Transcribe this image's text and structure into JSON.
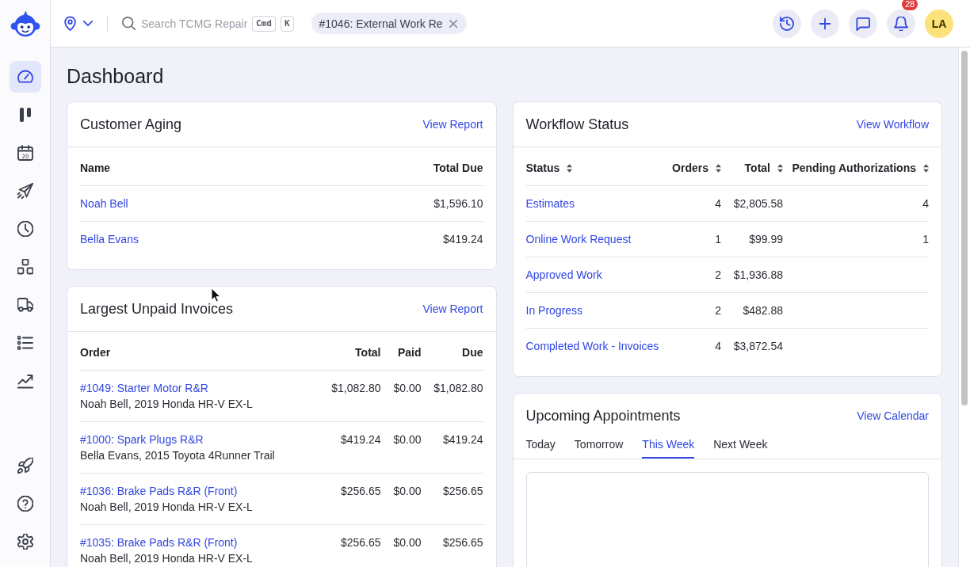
{
  "sidebar": {
    "nav_items": [
      {
        "selected": true
      },
      {
        "selected": false
      },
      {
        "selected": false,
        "date": "20"
      },
      {
        "selected": false
      },
      {
        "selected": false
      },
      {
        "selected": false
      },
      {
        "selected": false
      },
      {
        "selected": false
      },
      {
        "selected": false
      }
    ],
    "bottom_items": [
      {
        "selected": false
      },
      {
        "selected": false
      },
      {
        "selected": false
      }
    ]
  },
  "topbar": {
    "search": {
      "placeholder": "Search TCMG Repair",
      "shortcut_keys": [
        "Cmd",
        "K"
      ]
    },
    "open_tabs": [
      {
        "title": "#1046: External Work Re"
      }
    ],
    "notifications": {
      "count": "28"
    },
    "avatar": {
      "initials": "LA"
    }
  },
  "page": {
    "title": "Dashboard"
  },
  "customer_aging": {
    "title": "Customer Aging",
    "link": "View Report",
    "columns": [
      "Name",
      "Total Due"
    ],
    "rows": [
      {
        "name": "Noah Bell",
        "total_due": "$1,596.10"
      },
      {
        "name": "Bella Evans",
        "total_due": "$419.24"
      }
    ]
  },
  "largest_unpaid_invoices": {
    "title": "Largest Unpaid Invoices",
    "link": "View Report",
    "columns": [
      "Order",
      "Total",
      "Paid",
      "Due"
    ],
    "rows": [
      {
        "order": "#1049: Starter Motor R&R",
        "detail": "Noah Bell, 2019 Honda HR-V EX-L",
        "total": "$1,082.80",
        "paid": "$0.00",
        "due": "$1,082.80"
      },
      {
        "order": "#1000: Spark Plugs R&R",
        "detail": "Bella Evans, 2015 Toyota 4Runner Trail",
        "total": "$419.24",
        "paid": "$0.00",
        "due": "$419.24"
      },
      {
        "order": "#1036: Brake Pads R&R (Front)",
        "detail": "Noah Bell, 2019 Honda HR-V EX-L",
        "total": "$256.65",
        "paid": "$0.00",
        "due": "$256.65"
      },
      {
        "order": "#1035: Brake Pads R&R (Front)",
        "detail": "Noah Bell, 2019 Honda HR-V EX-L",
        "total": "$256.65",
        "paid": "$0.00",
        "due": "$256.65"
      }
    ]
  },
  "workflow_status": {
    "title": "Workflow Status",
    "link": "View Workflow",
    "columns": [
      "Status",
      "Orders",
      "Total",
      "Pending Authorizations"
    ],
    "rows": [
      {
        "status": "Estimates",
        "orders": "4",
        "total": "$2,805.58",
        "pending": "4"
      },
      {
        "status": "Online Work Request",
        "orders": "1",
        "total": "$99.99",
        "pending": "1"
      },
      {
        "status": "Approved Work",
        "orders": "2",
        "total": "$1,936.88"
      },
      {
        "status": "In Progress",
        "orders": "2",
        "total": "$482.88"
      },
      {
        "status": "Completed Work - Invoices",
        "orders": "4",
        "total": "$3,872.54"
      }
    ]
  },
  "upcoming_appointments": {
    "title": "Upcoming Appointments",
    "link": "View Calendar",
    "tabs": [
      {
        "label": "Today",
        "selected": false
      },
      {
        "label": "Tomorrow",
        "selected": false
      },
      {
        "label": "This Week",
        "selected": true
      },
      {
        "label": "Next Week",
        "selected": false
      }
    ]
  }
}
